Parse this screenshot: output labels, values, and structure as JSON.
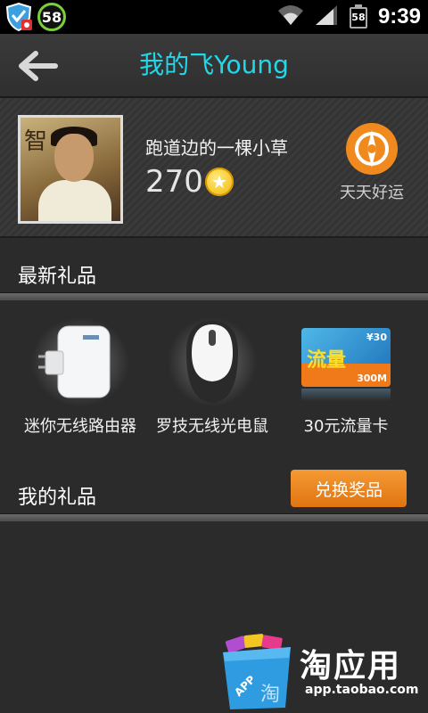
{
  "status_bar": {
    "notification_badge": "58",
    "battery_level": "58",
    "time": "9:39"
  },
  "header": {
    "title": "我的飞Young",
    "back_icon": "back-arrow-icon"
  },
  "profile": {
    "username": "跑道边的一棵小草",
    "coins": "270",
    "coin_icon": "star-coin-icon",
    "daily_label": "天天好运",
    "daily_icon": "compass-icon",
    "avatar_text": "智"
  },
  "latest_gifts": {
    "title": "最新礼品",
    "items": [
      {
        "label": "迷你无线路由器",
        "icon": "router-icon"
      },
      {
        "label": "罗技无线光电鼠",
        "icon": "mouse-icon"
      },
      {
        "label": "30元流量卡",
        "icon": "data-card-icon",
        "card_text": "流量",
        "card_sub": "300M",
        "card_price": "¥30"
      }
    ]
  },
  "my_gifts": {
    "title": "我的礼品",
    "exchange_button": "兑换奖品"
  },
  "watermark": {
    "text": "淘应用",
    "url": "app.taobao.com",
    "bag_label": "APP",
    "bag_char": "淘"
  },
  "colors": {
    "title": "#22d7e8",
    "accent": "#f08a1e",
    "background": "#2b2b2b"
  }
}
